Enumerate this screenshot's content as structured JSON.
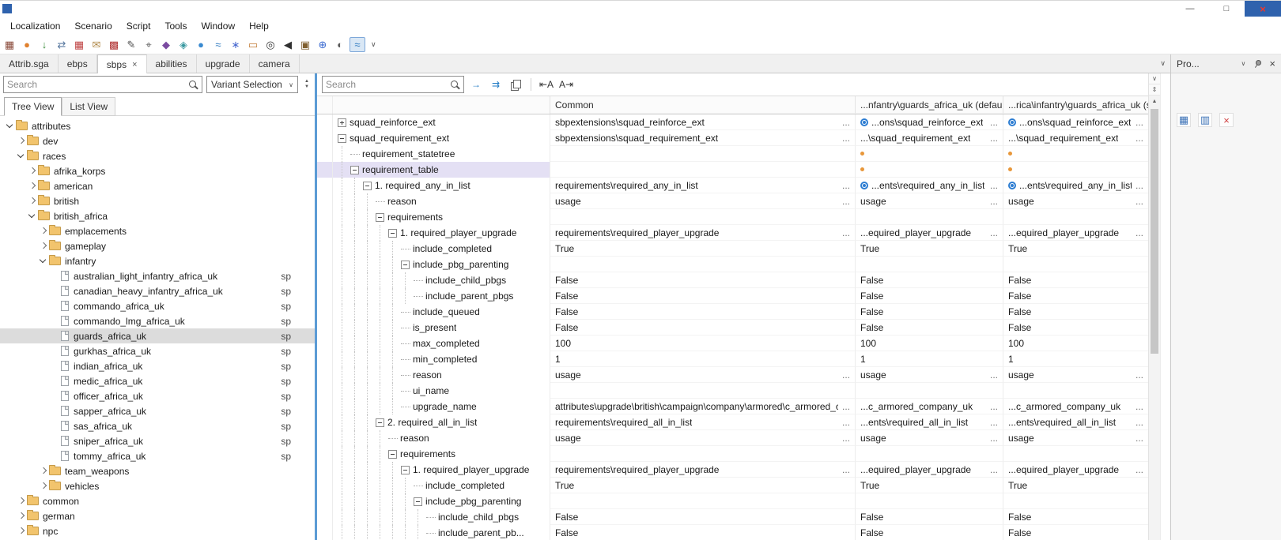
{
  "titlebar": {
    "minimize": "—",
    "maximize": "□",
    "close": "×"
  },
  "menu": {
    "items": [
      "Localization",
      "Scenario",
      "Script",
      "Tools",
      "Window",
      "Help"
    ]
  },
  "toolbar": {
    "overflow_glyph": "∨",
    "icons": [
      {
        "name": "scenario-grid-icon",
        "glyph": "▦",
        "color": "#8a4a3a"
      },
      {
        "name": "terrain-orb-icon",
        "glyph": "●",
        "color": "#e0812e"
      },
      {
        "name": "import-arrow-icon",
        "glyph": "↓",
        "color": "#3f8f3f"
      },
      {
        "name": "swap-arrows-icon",
        "glyph": "⇄",
        "color": "#5a7aa0"
      },
      {
        "name": "red-grid-icon",
        "glyph": "▦",
        "color": "#c04545"
      },
      {
        "name": "mail-icon",
        "glyph": "✉",
        "color": "#b08848"
      },
      {
        "name": "checker-icon",
        "glyph": "▩",
        "color": "#b03030"
      },
      {
        "name": "edit-pencil-icon",
        "glyph": "✎",
        "color": "#4a4a4a"
      },
      {
        "name": "picker-target-icon",
        "glyph": "⌖",
        "color": "#5a5a5a"
      },
      {
        "name": "shield-icon",
        "glyph": "◆",
        "color": "#7a4aa0"
      },
      {
        "name": "gem-icon",
        "glyph": "◈",
        "color": "#3898a0"
      },
      {
        "name": "droplet-icon",
        "glyph": "●",
        "color": "#3a8ad0"
      },
      {
        "name": "waves-icon",
        "glyph": "≈",
        "color": "#2f7ac0"
      },
      {
        "name": "snowflake-icon",
        "glyph": "∗",
        "color": "#4a6ad0"
      },
      {
        "name": "tray-icon",
        "glyph": "▭",
        "color": "#c07830"
      },
      {
        "name": "zoom-target-icon",
        "glyph": "◎",
        "color": "#3a3a3a"
      },
      {
        "name": "speaker-icon",
        "glyph": "◀",
        "color": "#303030"
      },
      {
        "name": "frame-icon",
        "glyph": "▣",
        "color": "#806030"
      },
      {
        "name": "add-circle-icon",
        "glyph": "⊕",
        "color": "#3a6ad0"
      },
      {
        "name": "history-clock-icon",
        "glyph": "◐",
        "color": "#5a5a5a"
      },
      {
        "name": "spline-tool-icon",
        "glyph": "≈",
        "color": "#2f7ac0",
        "active": true
      }
    ]
  },
  "tabs": {
    "overflow_glyph": "∨",
    "close_glyph": "×",
    "items": [
      {
        "label": "Attrib.sga"
      },
      {
        "label": "ebps"
      },
      {
        "label": "sbps",
        "active": true,
        "closable": true
      },
      {
        "label": "abilities"
      },
      {
        "label": "upgrade"
      },
      {
        "label": "camera"
      }
    ]
  },
  "sidebar": {
    "search_placeholder": "Search",
    "variant_selector": "Variant Selection",
    "view_tabs": [
      {
        "label": "Tree View",
        "active": true
      },
      {
        "label": "List View",
        "active": false
      }
    ],
    "sp_badge": "sp",
    "tree": [
      {
        "label": "attributes",
        "lvl": 0,
        "type": "folder",
        "chev": "exp"
      },
      {
        "label": "dev",
        "lvl": 1,
        "type": "folder",
        "chev": "col"
      },
      {
        "label": "races",
        "lvl": 1,
        "type": "folder",
        "chev": "exp"
      },
      {
        "label": "afrika_korps",
        "lvl": 2,
        "type": "folder",
        "chev": "col"
      },
      {
        "label": "american",
        "lvl": 2,
        "type": "folder",
        "chev": "col"
      },
      {
        "label": "british",
        "lvl": 2,
        "type": "folder",
        "chev": "col"
      },
      {
        "label": "british_africa",
        "lvl": 2,
        "type": "folder",
        "chev": "exp"
      },
      {
        "label": "emplacements",
        "lvl": 3,
        "type": "folder",
        "chev": "col"
      },
      {
        "label": "gameplay",
        "lvl": 3,
        "type": "folder",
        "chev": "col"
      },
      {
        "label": "infantry",
        "lvl": 3,
        "type": "folder",
        "chev": "exp"
      },
      {
        "label": "australian_light_infantry_africa_uk",
        "lvl": 4,
        "type": "file",
        "sp": true
      },
      {
        "label": "canadian_heavy_infantry_africa_uk",
        "lvl": 4,
        "type": "file",
        "sp": true
      },
      {
        "label": "commando_africa_uk",
        "lvl": 4,
        "type": "file",
        "sp": true
      },
      {
        "label": "commando_lmg_africa_uk",
        "lvl": 4,
        "type": "file",
        "sp": true
      },
      {
        "label": "guards_africa_uk",
        "lvl": 4,
        "type": "file",
        "sp": true,
        "sel": true
      },
      {
        "label": "gurkhas_africa_uk",
        "lvl": 4,
        "type": "file",
        "sp": true
      },
      {
        "label": "indian_africa_uk",
        "lvl": 4,
        "type": "file",
        "sp": true
      },
      {
        "label": "medic_africa_uk",
        "lvl": 4,
        "type": "file",
        "sp": true
      },
      {
        "label": "officer_africa_uk",
        "lvl": 4,
        "type": "file",
        "sp": true
      },
      {
        "label": "sapper_africa_uk",
        "lvl": 4,
        "type": "file",
        "sp": true
      },
      {
        "label": "sas_africa_uk",
        "lvl": 4,
        "type": "file",
        "sp": true
      },
      {
        "label": "sniper_africa_uk",
        "lvl": 4,
        "type": "file",
        "sp": true
      },
      {
        "label": "tommy_africa_uk",
        "lvl": 4,
        "type": "file",
        "sp": true
      },
      {
        "label": "team_weapons",
        "lvl": 3,
        "type": "folder",
        "chev": "col"
      },
      {
        "label": "vehicles",
        "lvl": 3,
        "type": "folder",
        "chev": "col"
      },
      {
        "label": "common",
        "lvl": 1,
        "type": "folder",
        "chev": "col"
      },
      {
        "label": "german",
        "lvl": 1,
        "type": "folder",
        "chev": "col"
      },
      {
        "label": "npc",
        "lvl": 1,
        "type": "folder",
        "chev": "col"
      }
    ]
  },
  "mainbar": {
    "search_placeholder": "Search",
    "icons": [
      {
        "name": "find-next-icon",
        "glyph": "→",
        "color": "#1f7ac4"
      },
      {
        "name": "find-all-icon",
        "glyph": "⇉",
        "color": "#1f7ac4"
      },
      {
        "name": "duplicate-icon",
        "css": "copy"
      },
      {
        "sep": true
      },
      {
        "name": "collapse-all-icon",
        "glyph": "⇤A",
        "color": "#333333"
      },
      {
        "name": "expand-all-icon",
        "glyph": "A⇥",
        "color": "#333333"
      }
    ]
  },
  "table": {
    "columns": [
      "",
      "Common",
      "...nfantry\\guards_africa_uk (default)",
      "...rica\\infantry\\guards_africa_uk (sp)"
    ],
    "rows": [
      {
        "name": "squad_reinforce_ext",
        "lvl": 0,
        "exp": "plus",
        "common": "sbpextensions\\squad_reinforce_ext",
        "cm": true,
        "c3": "...ons\\squad_reinforce_ext",
        "c3i": "target",
        "c3m": true,
        "c4": "...ons\\squad_reinforce_ext",
        "c4i": "target",
        "c4m": true
      },
      {
        "name": "squad_requirement_ext",
        "lvl": 0,
        "exp": "minus",
        "common": "sbpextensions\\squad_requirement_ext",
        "cm": true,
        "c3": "...\\squad_requirement_ext",
        "c3m": true,
        "c4": "...\\squad_requirement_ext",
        "c4m": true
      },
      {
        "name": "requirement_statetree",
        "lvl": 1,
        "c3i": "dot",
        "c4i": "dot"
      },
      {
        "name": "requirement_table",
        "lvl": 1,
        "exp": "minus",
        "sel": true,
        "c3i": "dot",
        "c4i": "dot"
      },
      {
        "name": "1. required_any_in_list",
        "lvl": 2,
        "exp": "minus",
        "common": "requirements\\required_any_in_list",
        "cm": true,
        "c3": "...ents\\required_any_in_list",
        "c3i": "target",
        "c3m": true,
        "c4": "...ents\\required_any_in_list",
        "c4i": "target",
        "c4m": true
      },
      {
        "name": "reason",
        "lvl": 3,
        "common": "usage",
        "cm": true,
        "c3": "usage",
        "c3m": true,
        "c4": "usage",
        "c4m": true
      },
      {
        "name": "requirements",
        "lvl": 3,
        "exp": "minus"
      },
      {
        "name": "1. required_player_upgrade",
        "lvl": 4,
        "exp": "minus",
        "common": "requirements\\required_player_upgrade",
        "cm": true,
        "c3": "...equired_player_upgrade",
        "c3m": true,
        "c4": "...equired_player_upgrade",
        "c4m": true
      },
      {
        "name": "include_completed",
        "lvl": 5,
        "common": "True",
        "c3": "True",
        "c4": "True"
      },
      {
        "name": "include_pbg_parenting",
        "lvl": 5,
        "exp": "minus"
      },
      {
        "name": "include_child_pbgs",
        "lvl": 6,
        "common": "False",
        "c3": "False",
        "c4": "False"
      },
      {
        "name": "include_parent_pbgs",
        "lvl": 6,
        "common": "False",
        "c3": "False",
        "c4": "False"
      },
      {
        "name": "include_queued",
        "lvl": 5,
        "common": "False",
        "c3": "False",
        "c4": "False"
      },
      {
        "name": "is_present",
        "lvl": 5,
        "common": "False",
        "c3": "False",
        "c4": "False"
      },
      {
        "name": "max_completed",
        "lvl": 5,
        "common": "100",
        "c3": "100",
        "c4": "100"
      },
      {
        "name": "min_completed",
        "lvl": 5,
        "common": "1",
        "c3": "1",
        "c4": "1"
      },
      {
        "name": "reason",
        "lvl": 5,
        "common": "usage",
        "cm": true,
        "c3": "usage",
        "c3m": true,
        "c4": "usage",
        "c4m": true
      },
      {
        "name": "ui_name",
        "lvl": 5
      },
      {
        "name": "upgrade_name",
        "lvl": 5,
        "common": "attributes\\upgrade\\british\\campaign\\company\\armored\\c_armored_c...",
        "cm": true,
        "c3": "...c_armored_company_uk",
        "c3m": true,
        "c4": "...c_armored_company_uk",
        "c4m": true
      },
      {
        "name": "2. required_all_in_list",
        "lvl": 3,
        "exp": "minus",
        "common": "requirements\\required_all_in_list",
        "cm": true,
        "c3": "...ents\\required_all_in_list",
        "c3m": true,
        "c4": "...ents\\required_all_in_list",
        "c4m": true
      },
      {
        "name": "reason",
        "lvl": 4,
        "common": "usage",
        "cm": true,
        "c3": "usage",
        "c3m": true,
        "c4": "usage",
        "c4m": true
      },
      {
        "name": "requirements",
        "lvl": 4,
        "exp": "minus"
      },
      {
        "name": "1. required_player_upgrade",
        "lvl": 5,
        "exp": "minus",
        "common": "requirements\\required_player_upgrade",
        "cm": true,
        "c3": "...equired_player_upgrade",
        "c3m": true,
        "c4": "...equired_player_upgrade",
        "c4m": true
      },
      {
        "name": "include_completed",
        "lvl": 6,
        "common": "True",
        "c3": "True",
        "c4": "True"
      },
      {
        "name": "include_pbg_parenting",
        "lvl": 6,
        "exp": "minus"
      },
      {
        "name": "include_child_pbgs",
        "lvl": 7,
        "common": "False",
        "c3": "False",
        "c4": "False"
      },
      {
        "name": "include_parent_pb...",
        "lvl": 7,
        "common": "False",
        "c3": "False",
        "c4": "False"
      }
    ]
  },
  "scrollbar": {
    "collapse_glyph": "∨",
    "sync_glyph": "⇕",
    "up_glyph": "▲"
  },
  "right_panel": {
    "title": "Pro...",
    "chevron": "∨",
    "close_glyph": "×",
    "tools": [
      {
        "name": "compare-view-icon",
        "glyph": "▦",
        "color": "#3f74b8"
      },
      {
        "name": "split-view-icon",
        "glyph": "▥",
        "color": "#3f74b8"
      },
      {
        "name": "clear-red-icon",
        "glyph": "×",
        "color": "#d04040"
      }
    ]
  },
  "colors": {
    "accent_blue": "#2d7dd2",
    "modified_orange": "#e8973a",
    "row_selection": "#e4e0f4",
    "tree_selection": "#dcdcdc",
    "splitter": "#5b9bd5"
  }
}
